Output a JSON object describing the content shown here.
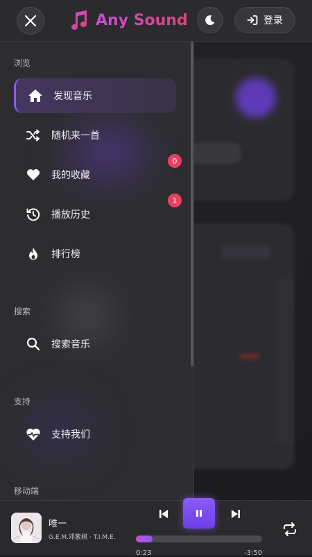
{
  "app": {
    "title": "Any Sound"
  },
  "header": {
    "login_label": "登录"
  },
  "sidebar": {
    "sections": [
      {
        "title": "浏览"
      },
      {
        "title": "搜索"
      },
      {
        "title": "支持"
      },
      {
        "title": "移动端"
      }
    ],
    "items": [
      {
        "label": "发现音乐",
        "icon": "home-icon",
        "active": true
      },
      {
        "label": "随机来一首",
        "icon": "shuffle-icon"
      },
      {
        "label": "我的收藏",
        "icon": "heart-icon",
        "badge": "0"
      },
      {
        "label": "播放历史",
        "icon": "history-icon",
        "badge": "1"
      },
      {
        "label": "排行榜",
        "icon": "fire-icon"
      },
      {
        "label": "搜索音乐",
        "icon": "search-icon"
      },
      {
        "label": "支持我们",
        "icon": "heart-pulse-icon"
      }
    ]
  },
  "player": {
    "title": "唯一",
    "artist": "G.E.M.邓紫棋 · T.I.M.E.",
    "current_time": "0:23",
    "remaining_time": "-3:50",
    "progress": 0.13
  },
  "colors": {
    "accent": "#8b5cf6",
    "badge": "#e8415f",
    "logo_gradient_start": "#c24fd2",
    "logo_gradient_end": "#e0447a"
  }
}
